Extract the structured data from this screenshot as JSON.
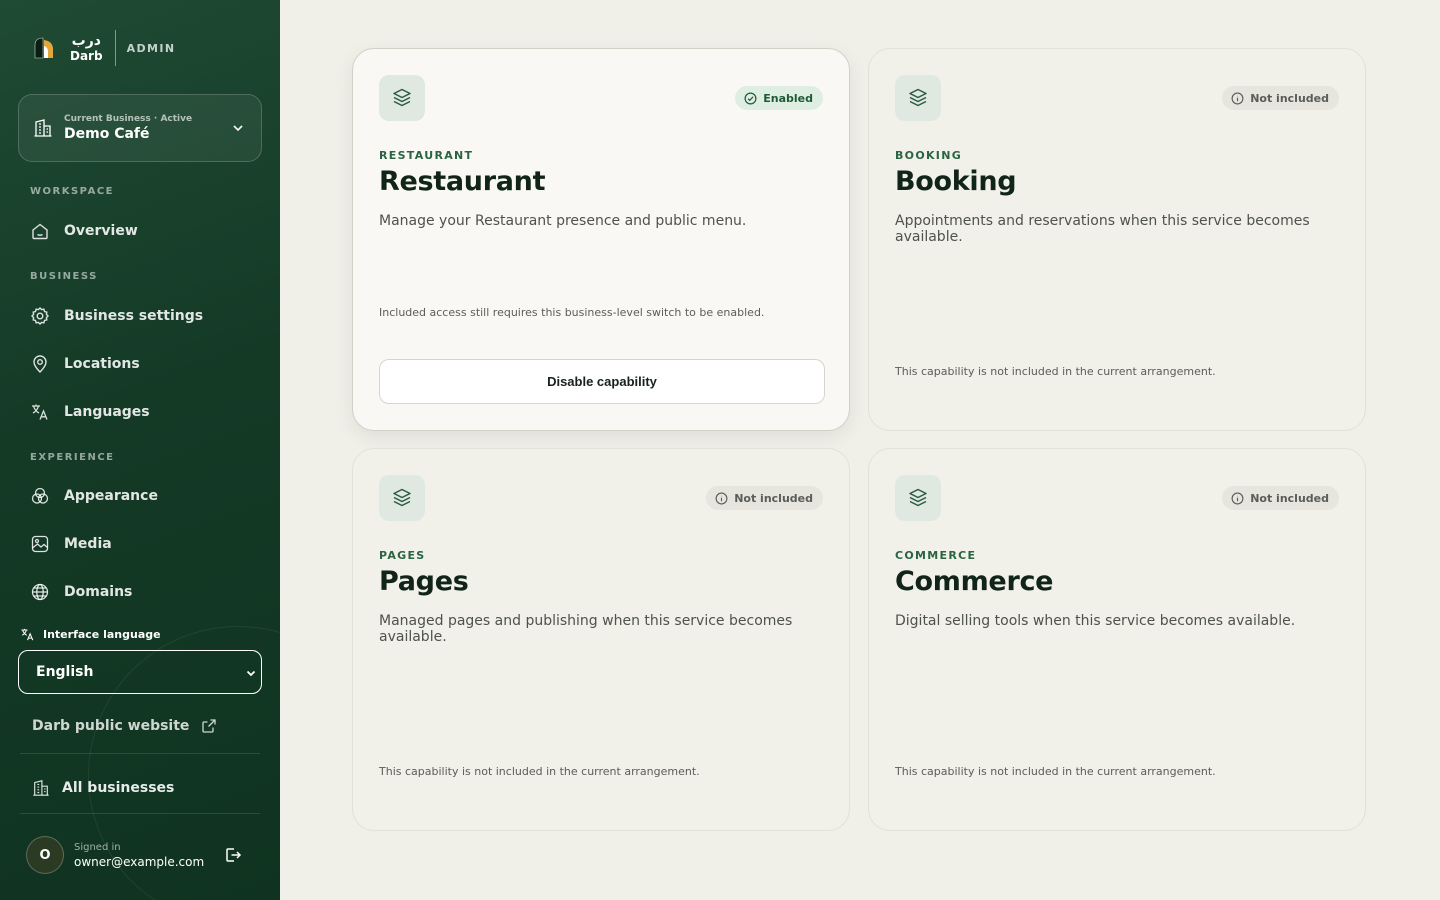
{
  "brand": {
    "arabic": "درب",
    "latin": "Darb",
    "admin_label": "ADMIN",
    "accent": "#e2a63b"
  },
  "business_switcher": {
    "caption": "Current Business · Active",
    "name": "Demo Café"
  },
  "sidebar": {
    "sections": {
      "workspace": "WORKSPACE",
      "business": "BUSINESS",
      "experience": "EXPERIENCE"
    },
    "items": [
      {
        "label": "Overview",
        "icon": "home-icon"
      },
      {
        "label": "Business settings",
        "icon": "gear-icon"
      },
      {
        "label": "Locations",
        "icon": "map-pin-icon"
      },
      {
        "label": "Languages",
        "icon": "translate-icon"
      },
      {
        "label": "Appearance",
        "icon": "palette-icon"
      },
      {
        "label": "Media",
        "icon": "image-icon"
      },
      {
        "label": "Domains",
        "icon": "globe-icon"
      }
    ],
    "interface_language_label": "Interface language",
    "interface_language_value": "English",
    "public_website_link": "Darb public website",
    "all_businesses": "All businesses",
    "user": {
      "initial": "O",
      "caption": "Signed in",
      "email": "owner@example.com"
    }
  },
  "capabilities": [
    {
      "kicker": "RESTAURANT",
      "title": "Restaurant",
      "description": "Manage your Restaurant presence and public menu.",
      "status": "Enabled",
      "note": "Included access still requires this business-level switch to be enabled.",
      "action": "Disable capability"
    },
    {
      "kicker": "BOOKING",
      "title": "Booking",
      "description": "Appointments and reservations when this service becomes available.",
      "status": "Not included",
      "note": "This capability is not included in the current arrangement."
    },
    {
      "kicker": "PAGES",
      "title": "Pages",
      "description": "Managed pages and publishing when this service becomes available.",
      "status": "Not included",
      "note": "This capability is not included in the current arrangement."
    },
    {
      "kicker": "COMMERCE",
      "title": "Commerce",
      "description": "Digital selling tools when this service becomes available.",
      "status": "Not included",
      "note": "This capability is not included in the current arrangement."
    }
  ],
  "colors": {
    "sidebar_bg": "#143a26",
    "page_bg": "#f0efe8",
    "enabled_badge": "#dfeee3",
    "accent_green": "#2a6443"
  }
}
